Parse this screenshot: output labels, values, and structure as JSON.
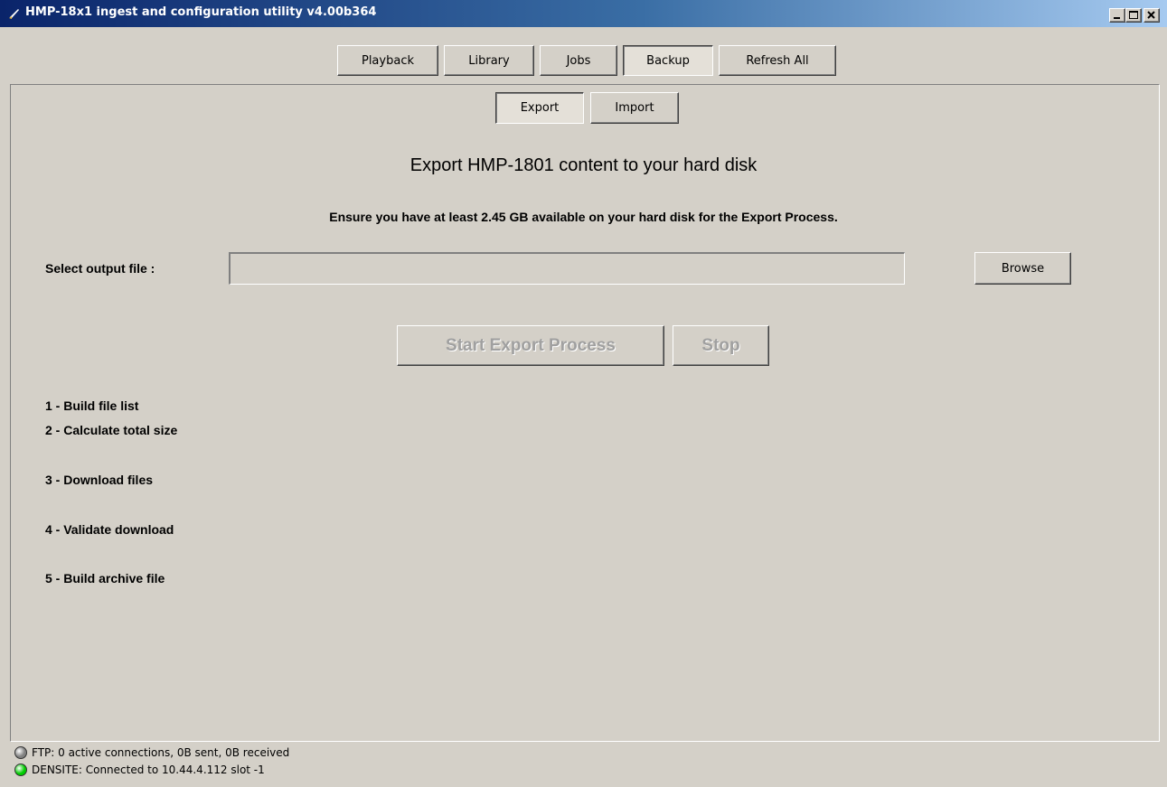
{
  "window": {
    "title": "HMP-18x1 ingest and configuration utility v4.00b364"
  },
  "nav": {
    "tabs": [
      {
        "label": "Playback"
      },
      {
        "label": "Library"
      },
      {
        "label": "Jobs"
      },
      {
        "label": "Backup",
        "selected": true
      },
      {
        "label": "Refresh All"
      }
    ]
  },
  "subnav": {
    "tabs": [
      {
        "label": "Export",
        "selected": true
      },
      {
        "label": "Import"
      }
    ]
  },
  "export": {
    "heading": "Export HMP-1801 content to your hard disk",
    "notice": "Ensure you have at least 2.45 GB available on your hard disk for the Export Process.",
    "output_label": "Select output file :",
    "output_value": "",
    "browse_label": "Browse",
    "start_label": "Start Export Process",
    "stop_label": "Stop",
    "steps": [
      "1 - Build file list",
      "2 - Calculate total size",
      "3 - Download files",
      "4 - Validate download",
      "5 - Build archive file"
    ]
  },
  "status": {
    "ftp": {
      "text": "FTP: 0 active connections, 0B sent, 0B received",
      "color": "#808080"
    },
    "densite": {
      "text": "DENSITE: Connected to 10.44.4.112 slot -1",
      "color": "#00cc00"
    }
  }
}
